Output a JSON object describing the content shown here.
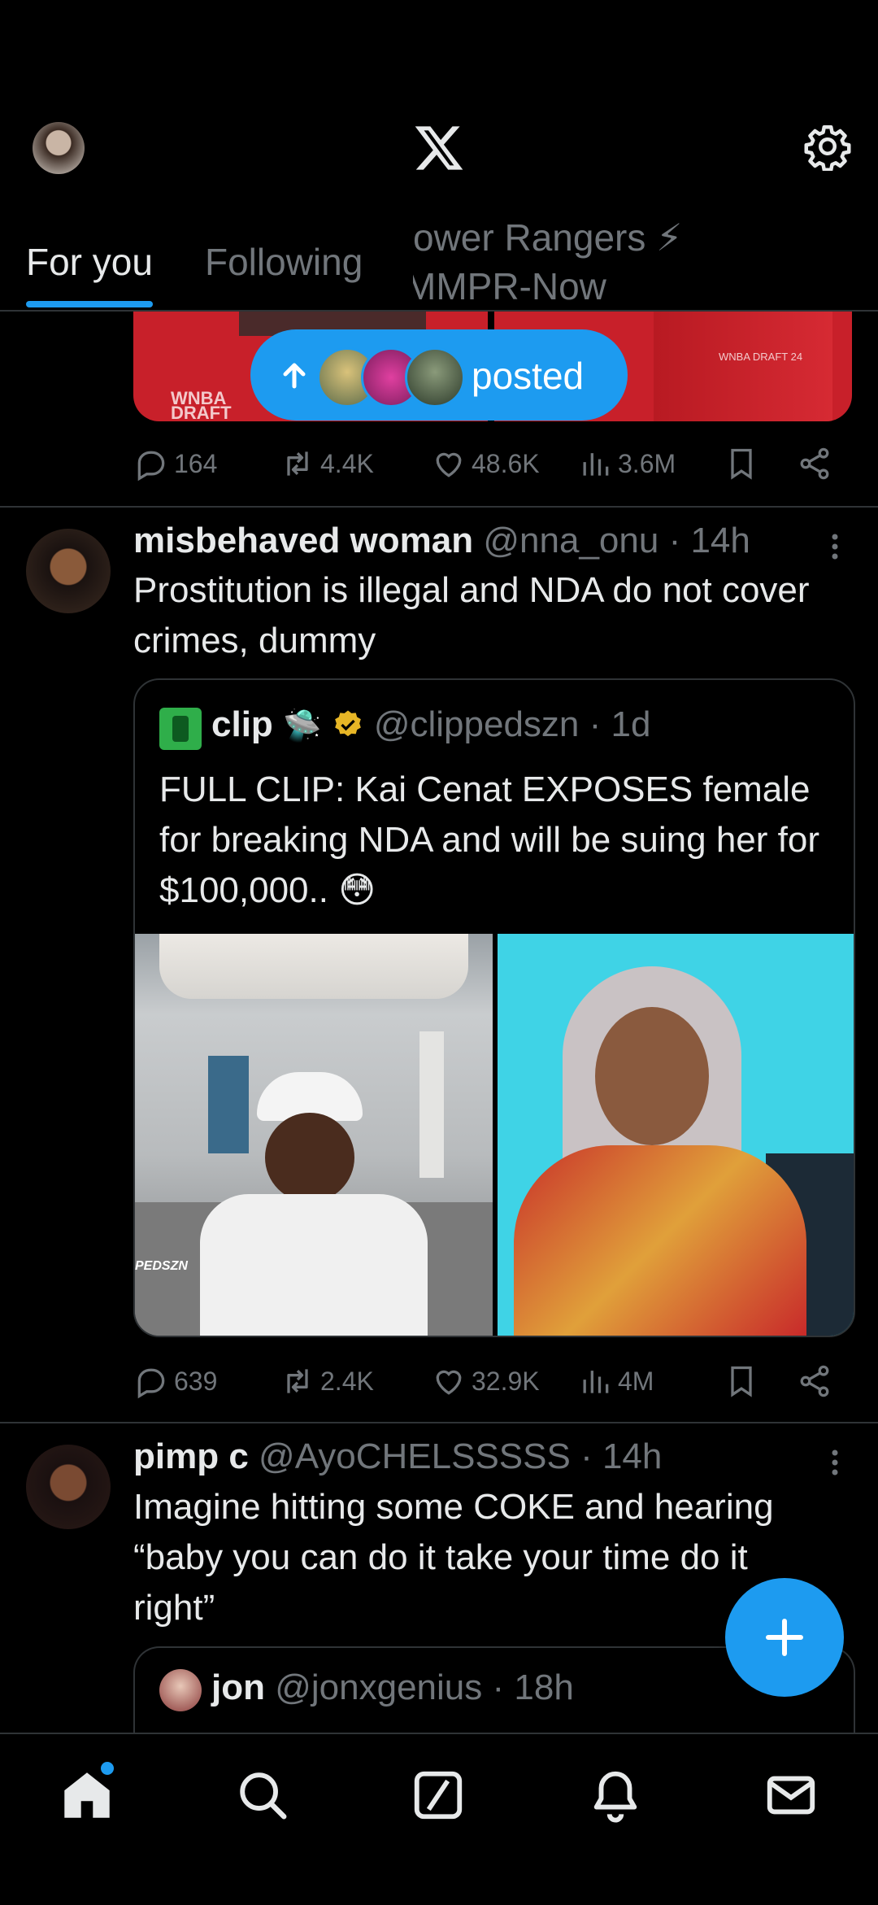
{
  "header": {
    "logo_icon": "x-logo",
    "settings_icon": "gear-icon",
    "tabs": [
      {
        "label": "For you",
        "active": true
      },
      {
        "label": "Following",
        "active": false
      },
      {
        "label_line1": "ower Rangers ⚡",
        "label_line2": "MMPR-Now",
        "active": false
      }
    ]
  },
  "new_posts_pill": {
    "label": "posted"
  },
  "tweets": [
    {
      "stats": {
        "replies": "164",
        "reposts": "4.4K",
        "likes": "48.6K",
        "views": "3.6M"
      }
    },
    {
      "name": "misbehaved woman",
      "handle": "@nna_onu",
      "time": "· 14h",
      "text": "Prostitution is illegal and NDA do not cover crimes, dummy",
      "quote": {
        "name": "clip",
        "emoji": "🛸",
        "handle": "@clippedszn",
        "time": "· 1d",
        "text": "FULL CLIP: Kai Cenat EXPOSES female for breaking NDA and will be suing her for $100,000.. 😳",
        "watermark": "PEDSZN"
      },
      "stats": {
        "replies": "639",
        "reposts": "2.4K",
        "likes": "32.9K",
        "views": "4M"
      }
    },
    {
      "name": "pimp c",
      "handle": "@AyoCHELSSSSS",
      "time": "· 14h",
      "text": "Imagine hitting some COKE and hearing “baby you can do it take your time do it right”",
      "quote": {
        "name": "jon",
        "handle": "@jonxgenius",
        "time": "· 18h"
      }
    }
  ],
  "partial_image_text": {
    "left": "WNBA DRAFT",
    "right": "WNBA DRAFT 24"
  },
  "colors": {
    "accent": "#1d9bf0",
    "bg": "#000000",
    "muted": "#71767b",
    "divider": "#2f3336"
  },
  "bottom_nav": [
    "home-icon",
    "search-icon",
    "grok-icon",
    "notifications-icon",
    "messages-icon"
  ]
}
